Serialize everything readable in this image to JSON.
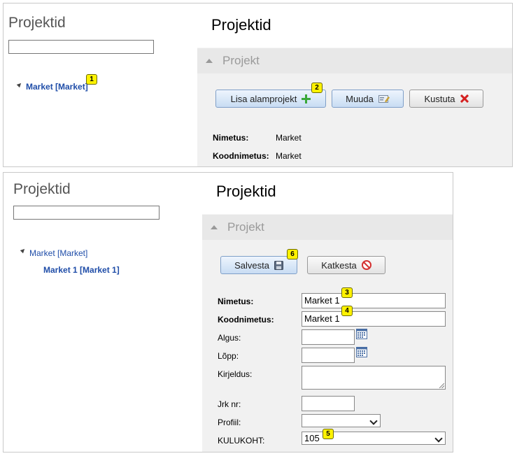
{
  "top_panel": {
    "sidebar_title": "Projektid",
    "tree": [
      {
        "label": "Market [Market]"
      }
    ],
    "main_title": "Projektid",
    "section_label": "Projekt",
    "buttons": {
      "add_sub": "Lisa alamprojekt",
      "edit": "Muuda",
      "delete": "Kustuta"
    },
    "fields": [
      {
        "label": "Nimetus:",
        "value": "Market"
      },
      {
        "label": "Koodnimetus:",
        "value": "Market"
      }
    ],
    "badges": [
      "1",
      "2"
    ]
  },
  "bottom_panel": {
    "sidebar_title": "Projektid",
    "tree": [
      {
        "label": "Market [Market]"
      },
      {
        "label": "Market 1 [Market 1]"
      }
    ],
    "main_title": "Projektid",
    "section_label": "Projekt",
    "buttons": {
      "save": "Salvesta",
      "cancel": "Katkesta"
    },
    "form": {
      "name_label": "Nimetus:",
      "name_value": "Market 1",
      "code_label": "Koodnimetus:",
      "code_value": "Market 1",
      "start_label": "Algus:",
      "start_value": "",
      "end_label": "Lõpp:",
      "end_value": "",
      "description_label": "Kirjeldus:",
      "order_label": "Jrk nr:",
      "order_value": "",
      "profile_label": "Profiil:",
      "profile_value": "",
      "costcenter_label": "KULUKOHT:",
      "costcenter_value": "105"
    },
    "badges": [
      "3",
      "4",
      "5",
      "6"
    ]
  },
  "colors": {
    "link": "#1f4da8",
    "badge": "#fff200",
    "section_bg": "#f1f1f1",
    "plus_icon": "#3aa83a",
    "delete_icon": "#d42020",
    "cancel_icon": "#d43030"
  }
}
